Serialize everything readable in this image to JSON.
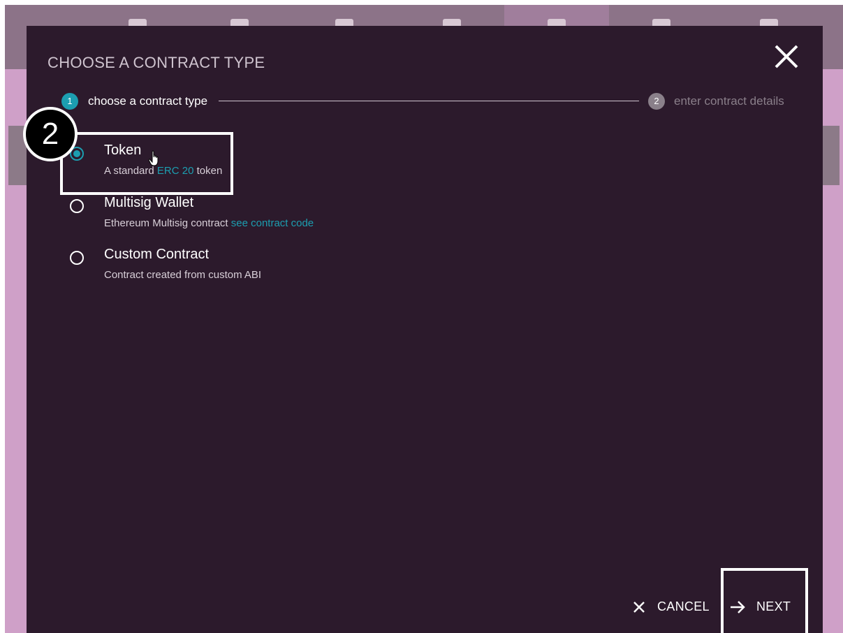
{
  "modal": {
    "title": "CHOOSE A CONTRACT TYPE",
    "close_icon": "close-icon"
  },
  "stepper": {
    "steps": [
      {
        "number": "1",
        "label": "choose a contract type",
        "state": "active",
        "color": "#1c9eb0"
      },
      {
        "number": "2",
        "label": "enter contract details",
        "state": "inactive",
        "color": "#8a808a"
      }
    ]
  },
  "options": [
    {
      "title": "Token",
      "desc_prefix": "A standard ",
      "link": "ERC 20",
      "desc_suffix": " token",
      "selected": true
    },
    {
      "title": "Multisig Wallet",
      "desc_prefix": "Ethereum Multisig contract ",
      "link": "see contract code",
      "desc_suffix": "",
      "selected": false
    },
    {
      "title": "Custom Contract",
      "desc_prefix": "Contract created from custom ABI",
      "link": "",
      "desc_suffix": "",
      "selected": false
    }
  ],
  "footer": {
    "cancel_label": "CANCEL",
    "next_label": "NEXT"
  },
  "annotation": {
    "badge_number": "2"
  },
  "colors": {
    "accent": "#1c9eb0",
    "modal_bg": "#2c1a2c",
    "page_bg": "#cfa0c8"
  },
  "icons": [
    "close-icon",
    "cancel-x-icon",
    "arrow-right-icon",
    "hand-cursor-icon"
  ]
}
